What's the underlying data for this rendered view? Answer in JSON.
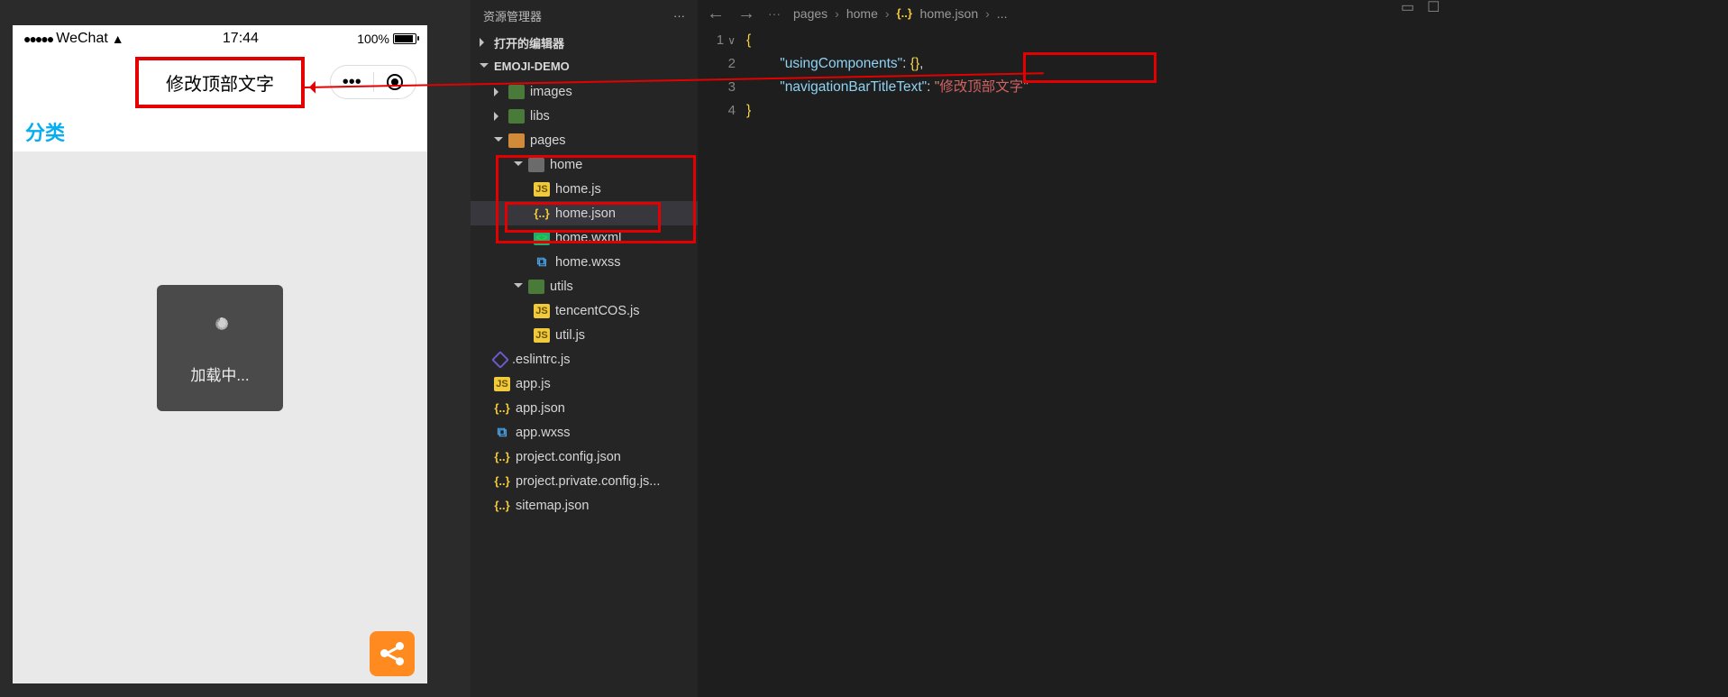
{
  "phone": {
    "carrier": "WeChat",
    "time": "17:44",
    "battery_pct": "100%",
    "nav_title": "修改顶部文字",
    "sort_label": "分类",
    "loading": "加载中..."
  },
  "explorer": {
    "title": "资源管理器",
    "open_editors": "打开的编辑器",
    "project": "EMOJI-DEMO",
    "tree": {
      "images": "images",
      "libs": "libs",
      "pages": "pages",
      "home": "home",
      "home_js": "home.js",
      "home_json": "home.json",
      "home_wxml": "home.wxml",
      "home_wxss": "home.wxss",
      "utils": "utils",
      "tencentcos": "tencentCOS.js",
      "util_js": "util.js",
      "eslintrc": ".eslintrc.js",
      "app_js": "app.js",
      "app_json": "app.json",
      "app_wxss": "app.wxss",
      "proj_config": "project.config.json",
      "proj_private": "project.private.config.js...",
      "sitemap": "sitemap.json"
    }
  },
  "breadcrumb": {
    "a": "pages",
    "b": "home",
    "c": "home.json",
    "d": "..."
  },
  "lines": {
    "l1": "1",
    "l2": "2",
    "l3": "3",
    "l4": "4"
  },
  "code": {
    "k1": "\"usingComponents\"",
    "v1": "{}",
    "k2": "\"navigationBarTitleText\"",
    "v2": "修改顶部文字"
  }
}
